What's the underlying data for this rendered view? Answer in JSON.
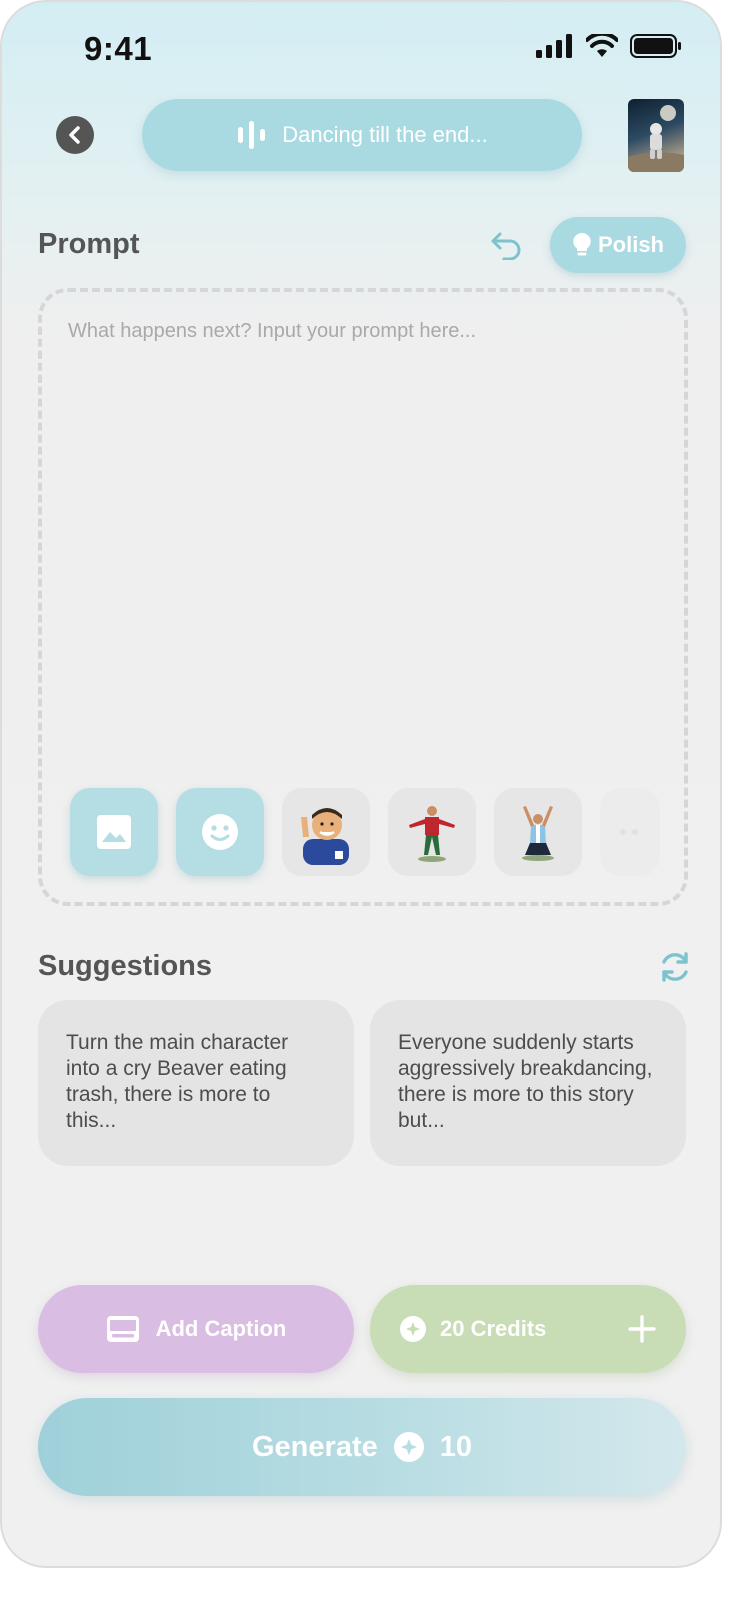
{
  "status_bar": {
    "time": "9:41"
  },
  "header": {
    "song_title": "Dancing till the end..."
  },
  "prompt": {
    "title": "Prompt",
    "polish_label": "Polish",
    "placeholder": "What happens next? Input your prompt here...",
    "attachments": [
      {
        "icon": "image-icon"
      },
      {
        "icon": "emoji-icon"
      },
      {
        "sticker": "player-peace-sign"
      },
      {
        "sticker": "player-red-kit"
      },
      {
        "sticker": "player-kneeling"
      }
    ]
  },
  "suggestions": {
    "title": "Suggestions",
    "items": [
      "Turn the main character into a cry Beaver eating trash, there is more to this...",
      "Everyone suddenly starts aggressively breakdancing, there is more to this story but..."
    ]
  },
  "actions": {
    "caption_label": "Add Caption",
    "credits_label": "20 Credits",
    "generate_label": "Generate",
    "generate_cost": "10"
  },
  "colors": {
    "accent": "#a9dae2",
    "caption": "#d9bde2",
    "credits": "#c8dcb5",
    "background": "#f0f0f0"
  }
}
